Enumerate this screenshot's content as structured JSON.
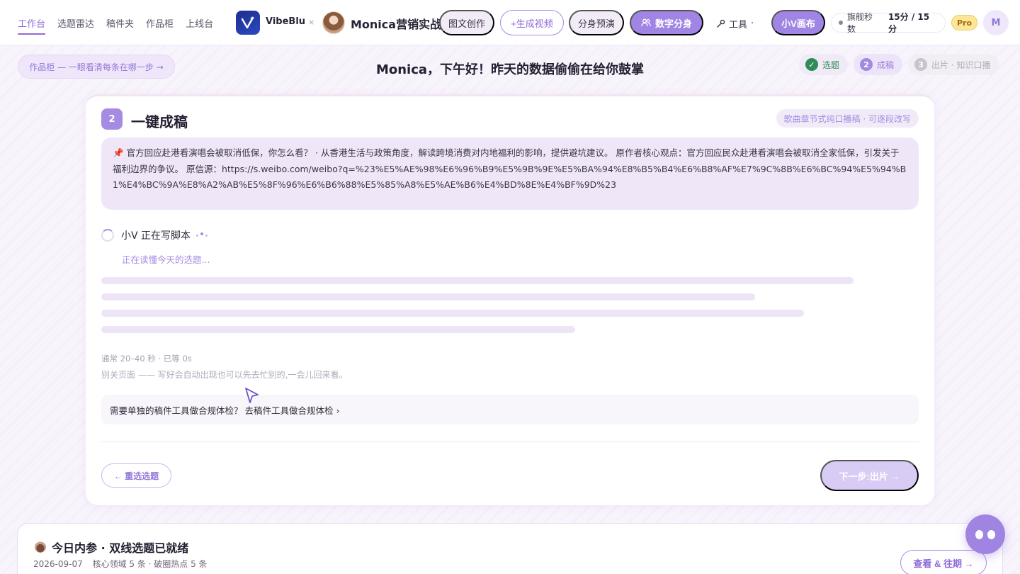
{
  "nav": {
    "links": [
      "工作台",
      "选题雷达",
      "稿件夹",
      "作品柜",
      "上线台"
    ],
    "brand": "VibeBlu",
    "separator": "×",
    "studio": "Monica营销实战",
    "buttons": {
      "graphic": "图文创作",
      "video": "+生成视频",
      "preview": "分身预演",
      "twin": "数字分身",
      "tools": "工具",
      "tools_suffix": "·",
      "canvas": "小V画布"
    },
    "quota_label": "旗舰秒数",
    "quota_value": "15分 / 15分",
    "pro_badge": "Pro",
    "user_initial": "M"
  },
  "subheader": {
    "shelf_link": "作品柜 — 一眼看清每条在哪一步 →",
    "greeting": "Monica，下午好！昨天的数据偷偷在给你鼓掌",
    "steps": [
      {
        "num": "✓",
        "label": "选题",
        "state": "done"
      },
      {
        "num": "2",
        "label": "成稿",
        "state": "current"
      },
      {
        "num": "3",
        "label": "出片 · 知识口播",
        "state": "todo"
      }
    ]
  },
  "card": {
    "step_number": "2",
    "title": "一键成稿",
    "mode_chip": "歌曲章节式纯口播稿 · 可逐段改写",
    "topic_pin": "📌",
    "topic_text": "官方回应赴港看演唱会被取消低保，你怎么看？ · 从香港生活与政策角度，解读跨境消费对内地福利的影响，提供避坑建议。 原作者核心观点：官方回应民众赴港看演唱会被取消全家低保，引发关于福利边界的争议。 原信源：https://s.weibo.com/weibo?q=%23%E5%AE%98%E6%96%B9%E5%9B%9E%E5%BA%94%E8%B5%B4%E6%B8%AF%E7%9C%8B%E6%BC%94%E5%94%B1%E4%BC%9A%E8%A2%AB%E5%8F%96%E6%B6%88%E5%85%A8%E5%AE%B6%E4%BD%8E%E4%BF%9D%23",
    "writing_status": "小V 正在写脚本",
    "reading_status": "正在读懂今天的选题...",
    "wait_meta": "通常 20–40 秒 · 已等 0s",
    "leave_hint": "别关页面 —— 写好会自动出现也可以先去忙别的,一会儿回来看。",
    "compliance_question": "需要单独的稿件工具做合规体检？",
    "compliance_link": "去稿件工具做合规体检 ›",
    "back_button": "← 重选选题",
    "next_button": "下一步:出片 →"
  },
  "digest": {
    "title": "今日内参 · 双线选题已就绪",
    "date": "2026-09-07",
    "summary": "核心领域 5 条 · 破圈热点 5 条",
    "history_button": "查看 & 往期 →"
  },
  "colors": {
    "accent": "#a085e4",
    "accent_text": "#8f6bd9",
    "done_green": "#2f8c58",
    "pro_yellow": "#fde69a"
  }
}
